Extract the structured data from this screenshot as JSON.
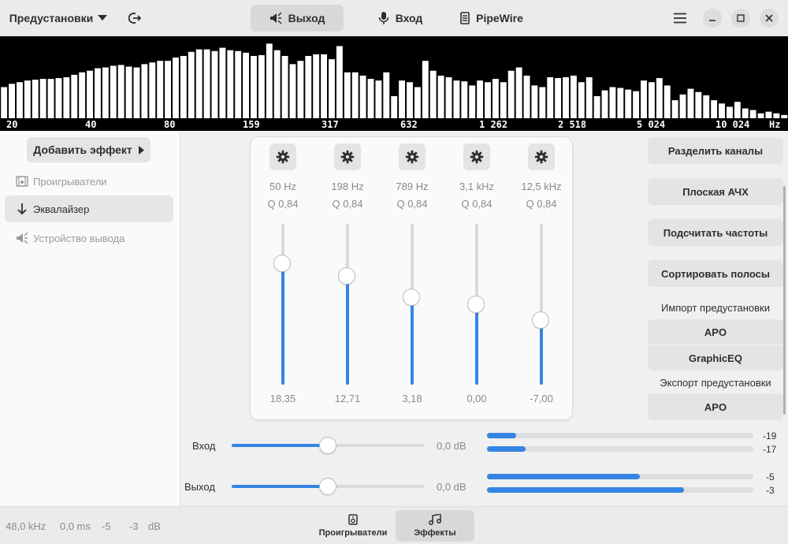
{
  "header": {
    "presets_label": "Предустановки",
    "tabs": [
      {
        "label": "Выход",
        "icon": "speaker-icon",
        "active": true
      },
      {
        "label": "Вход",
        "icon": "microphone-icon",
        "active": false
      },
      {
        "label": "PipeWire",
        "icon": "server-icon",
        "active": false
      }
    ]
  },
  "spectrum": {
    "freq_labels": [
      "20",
      "40",
      "80",
      "159",
      "317",
      "632",
      "1 262",
      "2 518",
      "5 024",
      "10 024",
      "Hz"
    ],
    "levels": [
      0.38,
      0.42,
      0.44,
      0.46,
      0.47,
      0.48,
      0.48,
      0.49,
      0.5,
      0.53,
      0.56,
      0.58,
      0.61,
      0.62,
      0.64,
      0.65,
      0.63,
      0.62,
      0.66,
      0.68,
      0.7,
      0.7,
      0.74,
      0.76,
      0.81,
      0.84,
      0.84,
      0.82,
      0.86,
      0.83,
      0.82,
      0.8,
      0.76,
      0.77,
      0.91,
      0.83,
      0.76,
      0.66,
      0.7,
      0.76,
      0.78,
      0.78,
      0.72,
      0.88,
      0.56,
      0.56,
      0.52,
      0.48,
      0.46,
      0.56,
      0.27,
      0.46,
      0.44,
      0.38,
      0.7,
      0.58,
      0.52,
      0.5,
      0.46,
      0.45,
      0.4,
      0.46,
      0.44,
      0.48,
      0.44,
      0.58,
      0.62,
      0.52,
      0.4,
      0.38,
      0.5,
      0.49,
      0.5,
      0.52,
      0.44,
      0.5,
      0.27,
      0.34,
      0.38,
      0.37,
      0.35,
      0.33,
      0.46,
      0.44,
      0.49,
      0.4,
      0.22,
      0.29,
      0.36,
      0.32,
      0.28,
      0.22,
      0.18,
      0.14,
      0.2,
      0.12,
      0.1,
      0.06,
      0.08,
      0.06,
      0.04
    ]
  },
  "sidebar": {
    "add_effect_label": "Добавить эффект",
    "items": [
      {
        "label": "Проигрыватели",
        "icon": "player-icon",
        "active": false
      },
      {
        "label": "Эквалайзер",
        "icon": "arrow-down-icon",
        "active": true
      },
      {
        "label": "Устройство вывода",
        "icon": "speaker-icon",
        "active": false
      }
    ]
  },
  "equalizer": {
    "bands": [
      {
        "freq": "50 Hz",
        "q": "Q 0,84",
        "gain": 18.35,
        "gain_label": "18,35"
      },
      {
        "freq": "198 Hz",
        "q": "Q 0,84",
        "gain": 12.71,
        "gain_label": "12,71"
      },
      {
        "freq": "789 Hz",
        "q": "Q 0,84",
        "gain": 3.18,
        "gain_label": "3,18"
      },
      {
        "freq": "3,1 kHz",
        "q": "Q 0,84",
        "gain": 0.0,
        "gain_label": "0,00"
      },
      {
        "freq": "12,5 kHz",
        "q": "Q 0,84",
        "gain": -7.0,
        "gain_label": "-7,00"
      }
    ],
    "gain_range": [
      -36,
      36
    ]
  },
  "actions": {
    "split_channels": "Разделить каналы",
    "flat_response": "Плоская АЧХ",
    "calc_frequencies": "Подсчитать частоты",
    "sort_bands": "Сортировать полосы",
    "import_label": "Импорт предустановки",
    "import_apo": "APO",
    "import_graphiceq": "GraphicEQ",
    "export_label": "Экспорт предустановки",
    "export_apo": "APO"
  },
  "gains": [
    {
      "label": "Вход",
      "value": "0,0 dB",
      "slider_fraction": 0.5,
      "levels": [
        {
          "value": "-19",
          "fraction": 0.11
        },
        {
          "value": "-17",
          "fraction": 0.145
        }
      ]
    },
    {
      "label": "Выход",
      "value": "0,0 dB",
      "slider_fraction": 0.5,
      "levels": [
        {
          "value": "-5",
          "fraction": 0.575
        },
        {
          "value": "-3",
          "fraction": 0.74
        }
      ]
    }
  ],
  "footer": {
    "sample_rate": "48,0 kHz",
    "latency": "0,0 ms",
    "level_left": "-5",
    "level_right": "-3",
    "level_unit": "dB",
    "tabs": [
      {
        "label": "Проигрыватели",
        "icon": "player-icon",
        "active": false
      },
      {
        "label": "Эффекты",
        "icon": "music-note-icon",
        "active": true
      }
    ]
  },
  "colors": {
    "accent": "#3584e4",
    "spectrum_bg": "#000000",
    "spectrum_bar": "#ffffff"
  }
}
